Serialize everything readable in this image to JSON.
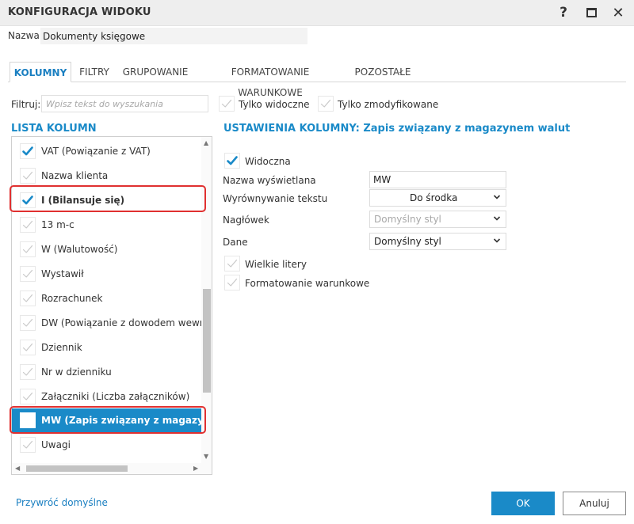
{
  "window": {
    "title": "KONFIGURACJA WIDOKU",
    "help_glyph": "?",
    "close_glyph": "✕",
    "icons": [
      "help-icon",
      "maximize-icon",
      "close-icon"
    ]
  },
  "name_field": {
    "label": "Nazwa:",
    "value": "Dokumenty księgowe"
  },
  "tabs": [
    {
      "label": "KOLUMNY",
      "active": true
    },
    {
      "label": "FILTRY",
      "active": false
    },
    {
      "label": "GRUPOWANIE",
      "active": false
    },
    {
      "label": "FORMATOWANIE WARUNKOWE",
      "active": false
    },
    {
      "label": "POZOSTAŁE",
      "active": false
    }
  ],
  "filter": {
    "label": "Filtruj:",
    "placeholder": "Wpisz tekst do wyszukania",
    "only_visible": {
      "label": "Tylko widoczne",
      "checked": false
    },
    "only_modified": {
      "label": "Tylko zmodyfikowane",
      "checked": false
    }
  },
  "column_list": {
    "title": "LISTA KOLUMN",
    "items": [
      {
        "label": "VAT (Powiązanie z VAT)",
        "checked": true
      },
      {
        "label": "Nazwa klienta",
        "checked": false
      },
      {
        "label": "I (Bilansuje się)",
        "checked": true
      },
      {
        "label": "13 m-c",
        "checked": false
      },
      {
        "label": "W (Walutowość)",
        "checked": false
      },
      {
        "label": "Wystawił",
        "checked": false
      },
      {
        "label": "Rozrachunek",
        "checked": false
      },
      {
        "label": "DW (Powiązanie z dowodem wewnętrz",
        "checked": false
      },
      {
        "label": "Dziennik",
        "checked": false
      },
      {
        "label": "Nr w dzienniku",
        "checked": false
      },
      {
        "label": "Załączniki (Liczba załączników)",
        "checked": false
      },
      {
        "label": "MW (Zapis związany z magazynem w",
        "checked": true,
        "selected": true
      },
      {
        "label": "Uwagi",
        "checked": false
      }
    ]
  },
  "settings": {
    "title": "USTAWIENIA KOLUMNY: Zapis związany z magazynem walut",
    "visible": {
      "label": "Widoczna",
      "checked": true
    },
    "display_name": {
      "label": "Nazwa wyświetlana",
      "value": "MW"
    },
    "text_align": {
      "label": "Wyrównywanie tekstu",
      "value": "Do środka"
    },
    "header": {
      "label": "Nagłówek",
      "value": "Domyślny styl"
    },
    "data": {
      "label": "Dane",
      "value": "Domyślny styl"
    },
    "uppercase": {
      "label": "Wielkie litery",
      "checked": false
    },
    "conditional": {
      "label": "Formatowanie warunkowe",
      "checked": false
    }
  },
  "footer": {
    "restore_label": "Przywróć domyślne",
    "ok_label": "OK",
    "cancel_label": "Anuluj"
  },
  "colors": {
    "accent": "#1a8ac8",
    "check_on": "#1a8ac8",
    "check_off": "#c9c9c9",
    "highlight": "#e03030"
  }
}
